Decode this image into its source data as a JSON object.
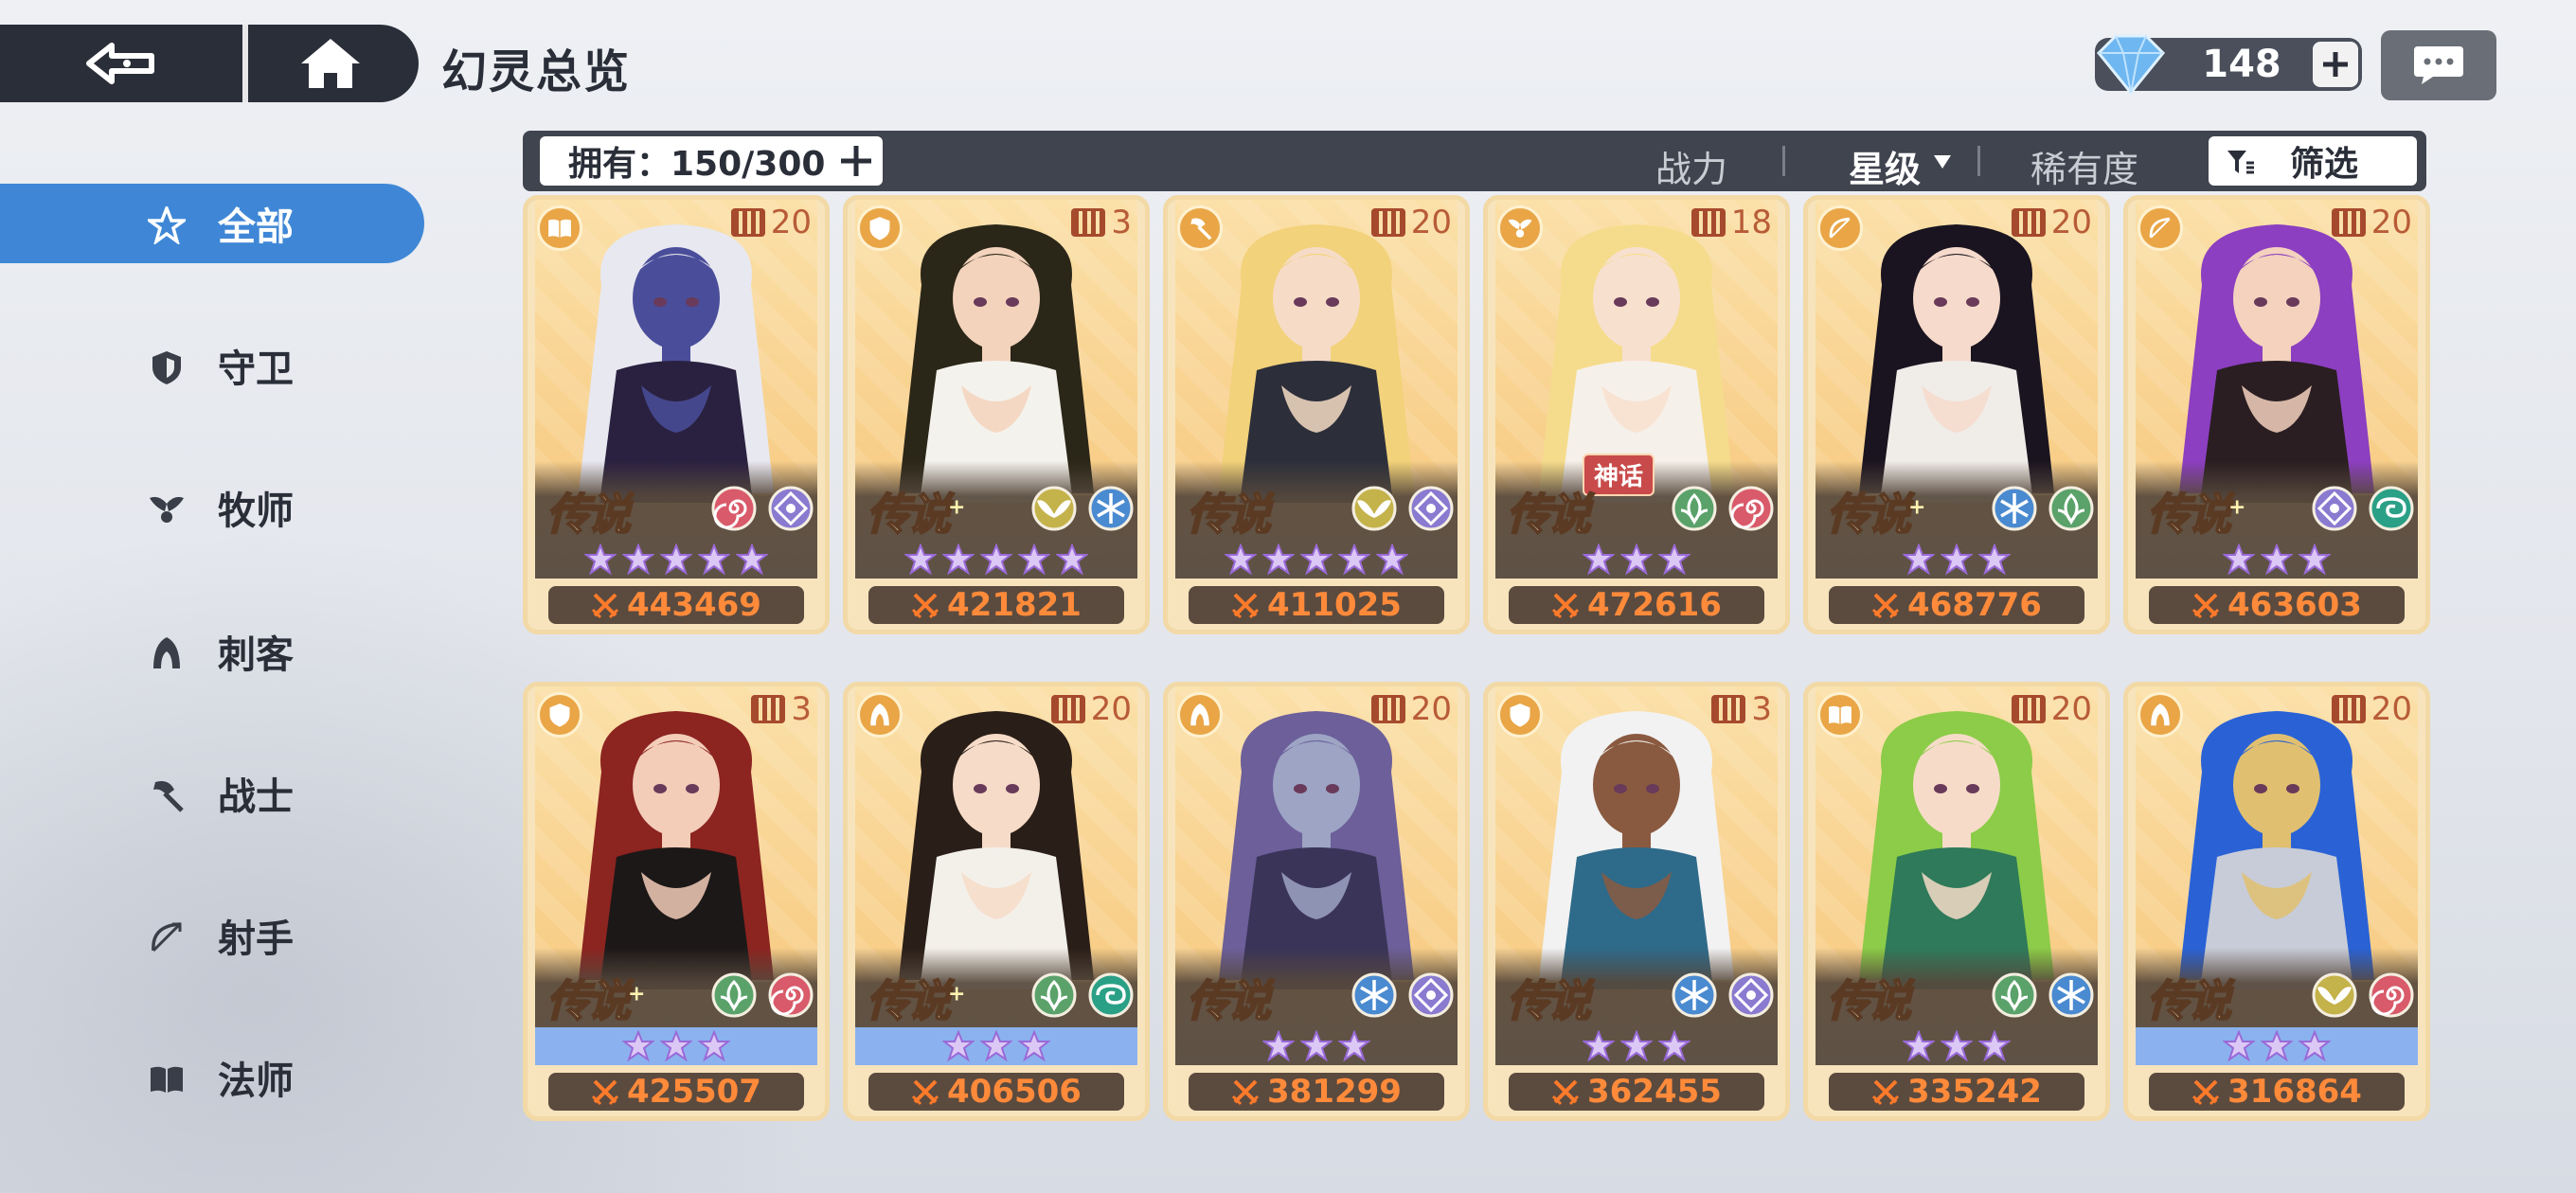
{
  "title": "幻灵总览",
  "currency": {
    "value": "148",
    "gem_color": "#6fb7f0"
  },
  "sidebar": [
    {
      "label": "全部",
      "icon": "all-star-icon",
      "active": true
    },
    {
      "label": "守卫",
      "icon": "shield-icon",
      "active": false
    },
    {
      "label": "牧师",
      "icon": "priest-wings-icon",
      "active": false
    },
    {
      "label": "刺客",
      "icon": "assassin-hood-icon",
      "active": false
    },
    {
      "label": "战士",
      "icon": "warrior-axe-icon",
      "active": false
    },
    {
      "label": "射手",
      "icon": "archer-bow-icon",
      "active": false
    },
    {
      "label": "法师",
      "icon": "mage-book-icon",
      "active": false
    }
  ],
  "filterbar": {
    "owned": "拥有：150/300",
    "sort_power": "战力",
    "sort_star": "星级",
    "sort_rarity": "稀有度",
    "filter": "筛选"
  },
  "accent_color": "#3f87d6",
  "cards": [
    {
      "class": "mage",
      "copies": "20",
      "rarity": "传说",
      "plus": false,
      "elements": [
        "spiral",
        "eye"
      ],
      "stars": 5,
      "stars_bg": "dark",
      "power": "443469",
      "hair": "#e8e8f0",
      "skin": "#4a4e9a",
      "outfit": "#2a2140",
      "myth": ""
    },
    {
      "class": "guard",
      "copies": "3",
      "rarity": "传说",
      "plus": true,
      "elements": [
        "wing",
        "snow"
      ],
      "stars": 5,
      "stars_bg": "dark",
      "power": "421821",
      "hair": "#2a2618",
      "skin": "#f3d3bc",
      "outfit": "#f4f2ec",
      "myth": ""
    },
    {
      "class": "warrior",
      "copies": "20",
      "rarity": "传说",
      "plus": false,
      "elements": [
        "wing",
        "eye"
      ],
      "stars": 5,
      "stars_bg": "dark",
      "power": "411025",
      "hair": "#f2d27a",
      "skin": "#f6dcc6",
      "outfit": "#2c2f3a",
      "myth": ""
    },
    {
      "class": "priest",
      "copies": "18",
      "rarity": "传说",
      "plus": false,
      "elements": [
        "leaf",
        "spiral"
      ],
      "stars": 3,
      "stars_bg": "dark",
      "power": "472616",
      "hair": "#f5dc8c",
      "skin": "#f8e0cf",
      "outfit": "#f6f0ea",
      "myth": "神话"
    },
    {
      "class": "archer",
      "copies": "20",
      "rarity": "传说",
      "plus": true,
      "elements": [
        "snow",
        "leaf"
      ],
      "stars": 3,
      "stars_bg": "dark",
      "power": "468776",
      "hair": "#1a1420",
      "skin": "#f6dacb",
      "outfit": "#f0ece8",
      "myth": ""
    },
    {
      "class": "archer",
      "copies": "20",
      "rarity": "传说",
      "plus": true,
      "elements": [
        "eye",
        "wind"
      ],
      "stars": 3,
      "stars_bg": "dark",
      "power": "463603",
      "hair": "#8c3fc0",
      "skin": "#f4d2be",
      "outfit": "#2a1e22",
      "myth": ""
    },
    {
      "class": "guard",
      "copies": "3",
      "rarity": "传说",
      "plus": true,
      "elements": [
        "leaf",
        "spiral"
      ],
      "stars": 3,
      "stars_bg": "blue",
      "power": "425507",
      "hair": "#8c2420",
      "skin": "#f3cdb8",
      "outfit": "#1c1818",
      "myth": ""
    },
    {
      "class": "assassin",
      "copies": "20",
      "rarity": "传说",
      "plus": true,
      "elements": [
        "leaf",
        "wind"
      ],
      "stars": 3,
      "stars_bg": "blue",
      "power": "406506",
      "hair": "#2a1e18",
      "skin": "#f6dcc8",
      "outfit": "#f3f0ea",
      "myth": ""
    },
    {
      "class": "assassin",
      "copies": "20",
      "rarity": "传说",
      "plus": false,
      "elements": [
        "snow",
        "eye"
      ],
      "stars": 3,
      "stars_bg": "dark",
      "power": "381299",
      "hair": "#6c5f9a",
      "skin": "#9da4c4",
      "outfit": "#3a3458",
      "myth": ""
    },
    {
      "class": "guard",
      "copies": "3",
      "rarity": "传说",
      "plus": false,
      "elements": [
        "snow",
        "eye"
      ],
      "stars": 3,
      "stars_bg": "dark",
      "power": "362455",
      "hair": "#f2f2f2",
      "skin": "#8a5a40",
      "outfit": "#2e6a8a",
      "myth": ""
    },
    {
      "class": "mage",
      "copies": "20",
      "rarity": "传说",
      "plus": false,
      "elements": [
        "leaf",
        "snow"
      ],
      "stars": 3,
      "stars_bg": "dark",
      "power": "335242",
      "hair": "#8ccc48",
      "skin": "#f6dcc8",
      "outfit": "#2e7a5a",
      "myth": ""
    },
    {
      "class": "assassin",
      "copies": "20",
      "rarity": "传说",
      "plus": false,
      "elements": [
        "wing",
        "spiral"
      ],
      "stars": 3,
      "stars_bg": "blue",
      "power": "316864",
      "hair": "#2a62d6",
      "skin": "#e0c070",
      "outfit": "#c8ccd8",
      "myth": ""
    }
  ]
}
